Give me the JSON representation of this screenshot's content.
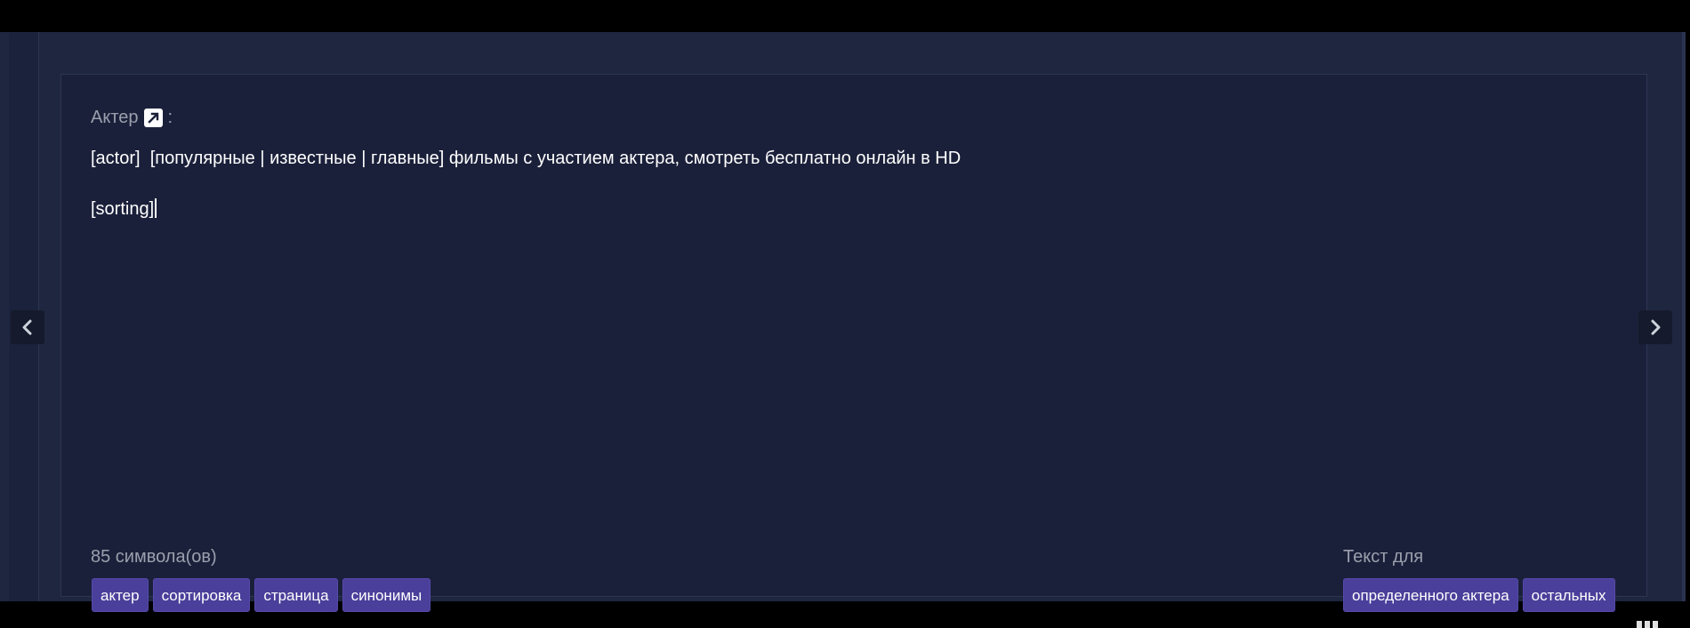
{
  "field": {
    "label": "Актер",
    "label_suffix": ":",
    "edit_icon": "external-edit-icon"
  },
  "editor": {
    "lines": [
      "[actor]  [популярные | известные | главные] фильмы с участием актера, смотреть бесплатно онлайн в HD",
      "[sorting]"
    ]
  },
  "footer": {
    "char_count": "85 символа(ов)",
    "insert_tags": [
      "актер",
      "сортировка",
      "страница",
      "синонимы"
    ],
    "text_for_label": "Текст для",
    "target_tags": [
      "определенного актера",
      "остальных"
    ]
  },
  "navigation": {
    "prev_icon": "chevron-left-icon",
    "next_icon": "chevron-right-icon"
  },
  "colors": {
    "background": "#000000",
    "panel": "#1e2640",
    "card": "#1b203a",
    "tag": "#4a3f9a",
    "muted_text": "#9aa0ad",
    "text": "#ffffff"
  }
}
